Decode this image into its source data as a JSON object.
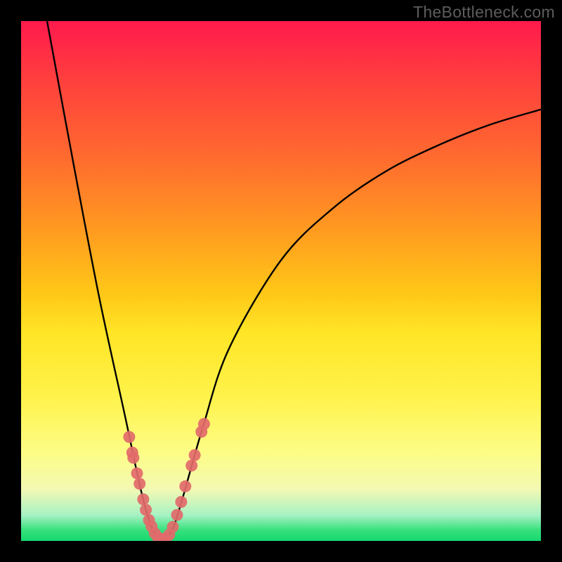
{
  "watermark": "TheBottleneck.com",
  "chart_data": {
    "type": "line",
    "title": "",
    "xlabel": "",
    "ylabel": "",
    "xlim": [
      0,
      100
    ],
    "ylim": [
      0,
      100
    ],
    "minimum_x": 27,
    "curve_points": [
      {
        "x": 5.0,
        "y": 100.0
      },
      {
        "x": 10.0,
        "y": 73.0
      },
      {
        "x": 15.0,
        "y": 47.0
      },
      {
        "x": 20.0,
        "y": 24.0
      },
      {
        "x": 23.0,
        "y": 10.0
      },
      {
        "x": 25.0,
        "y": 3.0
      },
      {
        "x": 27.0,
        "y": 0.0
      },
      {
        "x": 29.0,
        "y": 2.0
      },
      {
        "x": 31.0,
        "y": 8.0
      },
      {
        "x": 35.0,
        "y": 22.0
      },
      {
        "x": 40.0,
        "y": 37.0
      },
      {
        "x": 50.0,
        "y": 54.0
      },
      {
        "x": 60.0,
        "y": 64.0
      },
      {
        "x": 70.0,
        "y": 71.0
      },
      {
        "x": 80.0,
        "y": 76.0
      },
      {
        "x": 90.0,
        "y": 80.0
      },
      {
        "x": 100.0,
        "y": 83.0
      }
    ],
    "marker_points": [
      {
        "x": 20.8,
        "y": 20.0
      },
      {
        "x": 21.4,
        "y": 17.0
      },
      {
        "x": 21.6,
        "y": 16.0
      },
      {
        "x": 22.3,
        "y": 13.0
      },
      {
        "x": 22.8,
        "y": 11.0
      },
      {
        "x": 23.5,
        "y": 8.0
      },
      {
        "x": 24.0,
        "y": 6.0
      },
      {
        "x": 24.6,
        "y": 4.0
      },
      {
        "x": 25.1,
        "y": 2.8
      },
      {
        "x": 25.7,
        "y": 1.5
      },
      {
        "x": 26.3,
        "y": 0.7
      },
      {
        "x": 27.0,
        "y": 0.3
      },
      {
        "x": 27.8,
        "y": 0.5
      },
      {
        "x": 28.5,
        "y": 1.2
      },
      {
        "x": 29.2,
        "y": 2.7
      },
      {
        "x": 30.0,
        "y": 5.0
      },
      {
        "x": 30.8,
        "y": 7.5
      },
      {
        "x": 31.6,
        "y": 10.5
      },
      {
        "x": 32.8,
        "y": 14.5
      },
      {
        "x": 33.4,
        "y": 16.5
      },
      {
        "x": 34.7,
        "y": 21.0
      },
      {
        "x": 35.2,
        "y": 22.5
      }
    ],
    "marker_color": "#e26a6a",
    "curve_color": "#000000",
    "gradient_stops": [
      {
        "pos": 0.0,
        "color": "#ff1a4d"
      },
      {
        "pos": 0.5,
        "color": "#ffc617"
      },
      {
        "pos": 0.85,
        "color": "#fdfd86"
      },
      {
        "pos": 1.0,
        "color": "#17d86f"
      }
    ]
  }
}
